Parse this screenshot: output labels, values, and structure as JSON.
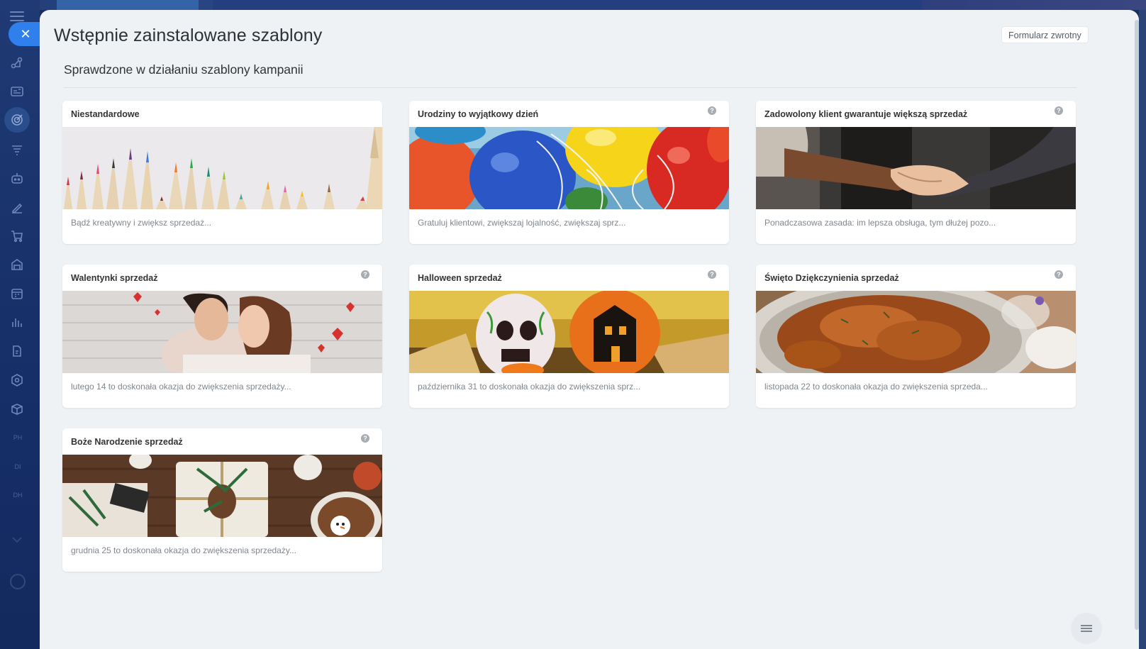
{
  "page": {
    "title": "Wstępnie zainstalowane szablony",
    "feedback_label": "Formularz zwrotny",
    "section_title": "Sprawdzone w działaniu szablony kampanii"
  },
  "sidebar": {
    "close_glyph": "✕",
    "icons": [
      "crm-icon",
      "contact-center-icon",
      "marketing-icon",
      "sales-funnel-icon",
      "robot-icon",
      "sign-icon",
      "cart-icon",
      "inventory-icon",
      "calendar-icon",
      "analytics-icon",
      "documents-icon",
      "automation-icon",
      "box-icon"
    ],
    "text_items": [
      "PH",
      "DI",
      "DH"
    ]
  },
  "templates": [
    {
      "title": "Niestandardowe",
      "description": "Bądź kreatywny i zwiększ sprzedaż...",
      "has_help": false,
      "image": "pencils"
    },
    {
      "title": "Urodziny to wyjątkowy dzień",
      "description": "Gratuluj klientowi, zwiększaj lojalność, zwiększaj sprz...",
      "has_help": true,
      "image": "balloons"
    },
    {
      "title": "Zadowolony klient gwarantuje większą sprzedaż",
      "description": "Ponadczasowa zasada: im lepsza obsługa, tym dłużej pozo...",
      "has_help": true,
      "image": "handshake"
    },
    {
      "title": "Walentynki sprzedaż",
      "description": "lutego 14 to doskonała okazja do zwiększenia sprzedaży...",
      "has_help": true,
      "image": "couple"
    },
    {
      "title": "Halloween sprzedaż",
      "description": "października 31 to doskonała okazja do zwiększenia sprz...",
      "has_help": true,
      "image": "pumpkins"
    },
    {
      "title": "Święto Dziękczynienia sprzedaż",
      "description": "listopada 22 to doskonała okazja do zwiększenia sprzeda...",
      "has_help": true,
      "image": "turkey"
    },
    {
      "title": "Boże Narodzenie sprzedaż",
      "description": "grudnia 25 to doskonała okazja do zwiększenia sprzedaży...",
      "has_help": true,
      "image": "gifts"
    }
  ],
  "help_glyph": "?"
}
